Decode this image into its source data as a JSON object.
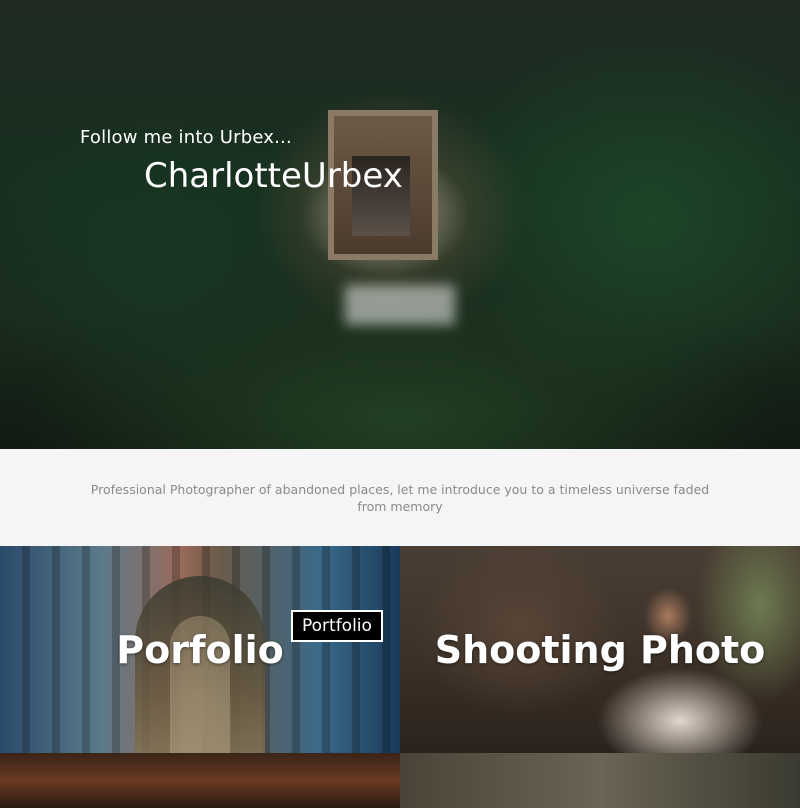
{
  "hero": {
    "subtitle": "Follow me into Urbex...",
    "title": "CharlotteUrbex"
  },
  "intro": {
    "text": "Professional Photographer of abandoned places, let me introduce you to a timeless universe faded from memory"
  },
  "tiles": [
    {
      "title": "Porfolio",
      "badge": "Portfolio"
    },
    {
      "title": "Shooting Photo"
    }
  ],
  "colors": {
    "intro_bg": "#f5f5f5",
    "intro_text": "#8a8a8a",
    "badge_bg": "#000000",
    "text_light": "#ffffff"
  }
}
